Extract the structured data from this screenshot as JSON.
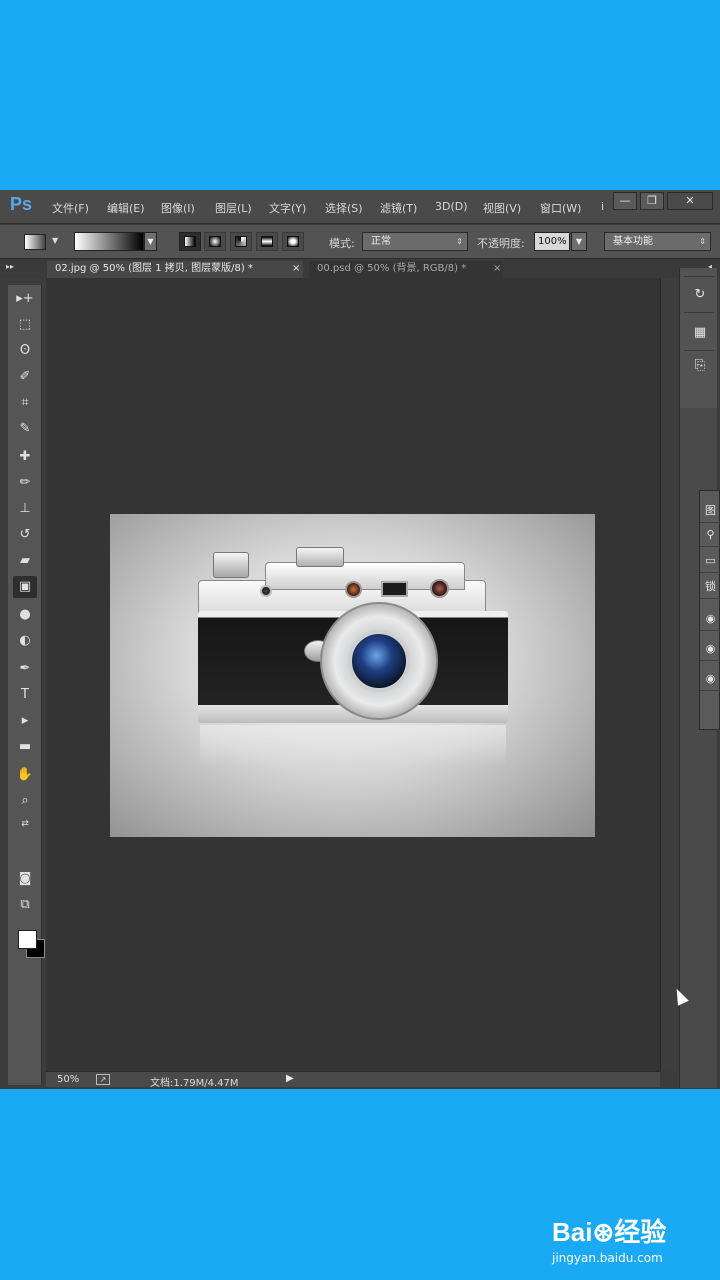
{
  "menubar": {
    "logo": "Ps",
    "items": [
      "文件(F)",
      "编辑(E)",
      "图像(I)",
      "图层(L)",
      "文字(Y)",
      "选择(S)",
      "滤镜(T)",
      "3D(D)",
      "视图(V)",
      "窗口(W)",
      "i"
    ],
    "window_controls": {
      "minimize": "—",
      "restore": "❐",
      "close": "✕"
    }
  },
  "options": {
    "mode_label": "模式:",
    "mode_value": "正常",
    "opacity_label": "不透明度:",
    "opacity_value": "100%",
    "workspace_value": "基本功能",
    "gradient_types": [
      "linear",
      "radial",
      "angle",
      "reflected",
      "diamond"
    ],
    "active_gradient_type": "linear"
  },
  "tabs": [
    {
      "label": "02.jpg @ 50% (图层 1 拷贝, 图层蒙版/8) *",
      "active": true
    },
    {
      "label": "00.psd @ 50% (背景, RGB/8) *",
      "active": false
    }
  ],
  "tab_close": "×",
  "collapse_arrows": "▸▸",
  "collapse_arrows_right": "◂",
  "toolbox": {
    "tools": [
      {
        "name": "move-tool",
        "glyph": "▸+"
      },
      {
        "name": "marquee-tool",
        "glyph": "⬚"
      },
      {
        "name": "lasso-tool",
        "glyph": "ʘ"
      },
      {
        "name": "quick-select-tool",
        "glyph": "✐"
      },
      {
        "name": "crop-tool",
        "glyph": "⌗"
      },
      {
        "name": "eyedropper-tool",
        "glyph": "✎"
      },
      {
        "name": "healing-brush-tool",
        "glyph": "✚"
      },
      {
        "name": "brush-tool",
        "glyph": "✏"
      },
      {
        "name": "clone-stamp-tool",
        "glyph": "⊥"
      },
      {
        "name": "history-brush-tool",
        "glyph": "↺"
      },
      {
        "name": "eraser-tool",
        "glyph": "▰"
      },
      {
        "name": "gradient-tool",
        "glyph": "▣",
        "active": true
      },
      {
        "name": "blur-tool",
        "glyph": "●"
      },
      {
        "name": "dodge-tool",
        "glyph": "◐"
      },
      {
        "name": "pen-tool",
        "glyph": "✒"
      },
      {
        "name": "type-tool",
        "glyph": "T"
      },
      {
        "name": "path-select-tool",
        "glyph": "▸"
      },
      {
        "name": "shape-tool",
        "glyph": "▬"
      },
      {
        "name": "hand-tool",
        "glyph": "✋"
      },
      {
        "name": "zoom-tool",
        "glyph": "⌕"
      }
    ],
    "quick_mask_glyph": "◙",
    "screen_mode_glyph": "⧉"
  },
  "statusbar": {
    "zoom": "50%",
    "doc_info": "文档:1.79M/4.47M",
    "arrow": "▶"
  },
  "right_dock": {
    "icons": [
      "history-panel-icon",
      "properties-panel-icon",
      "layer-comps-icon"
    ],
    "icon_glyphs": [
      "↻",
      "▦",
      "⎘"
    ],
    "flyout_items": [
      "图",
      "⚲",
      "▭",
      "锁",
      "◉",
      "◉",
      "◉"
    ]
  },
  "watermark": {
    "main": "Bai⊛经验",
    "url": "jingyan.baidu.com"
  },
  "colors": {
    "background": "#1aa9f5",
    "ps_blue": "#5aa8e6",
    "canvas_bg": "#343434"
  }
}
